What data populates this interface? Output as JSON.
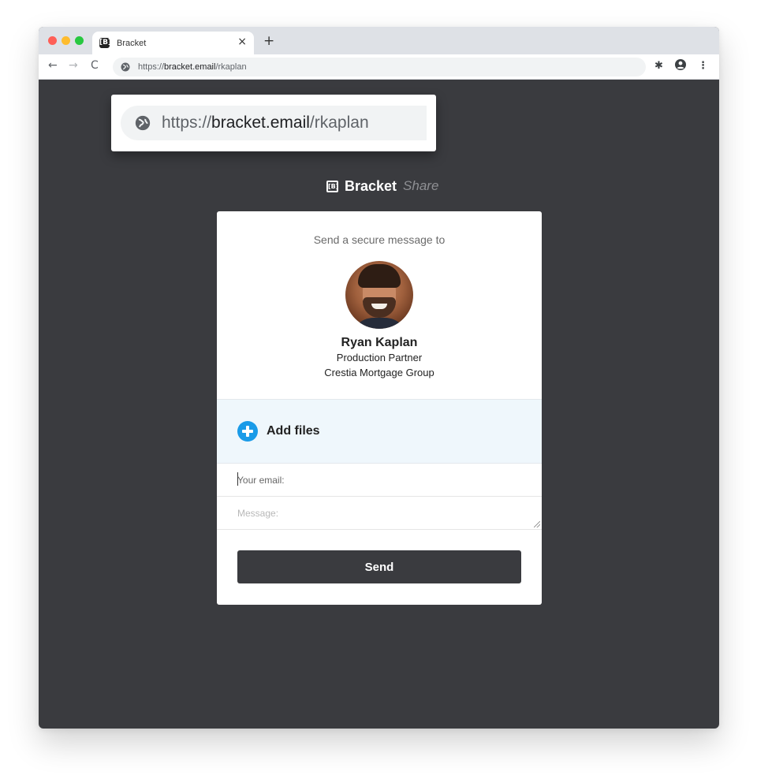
{
  "browser": {
    "tab_title": "Bracket",
    "tab_favicon": "[B]",
    "tab_close": "×",
    "new_tab": "+",
    "url_scheme": "https://",
    "url_host": "bracket.email",
    "url_path": "/rkaplan",
    "nav": {
      "back": "←",
      "forward": "→",
      "reload": "C"
    },
    "toolbar": {
      "extensions": "✱",
      "menu": "⋮"
    }
  },
  "callout": {
    "url_scheme": "https://",
    "url_host": "bracket.email",
    "url_path": "/rkaplan"
  },
  "brand": {
    "icon": "[B]",
    "name": "Bracket",
    "sub": "Share"
  },
  "card": {
    "intro": "Send a secure message to",
    "person": {
      "name": "Ryan Kaplan",
      "title": "Production Partner",
      "company": "Crestia Mortgage Group"
    },
    "add_files_label": "Add files",
    "email_placeholder": "Your email:",
    "message_placeholder": "Message:",
    "send_label": "Send"
  },
  "colors": {
    "page_bg": "#3a3b3f",
    "accent": "#1a9be8",
    "button": "#3a3b3f",
    "dropzone_bg": "#eff7fc"
  },
  "icons": [
    "close-icon",
    "plus-icon",
    "back-arrow-icon",
    "forward-arrow-icon",
    "reload-icon",
    "globe-icon",
    "extensions-icon",
    "profile-icon",
    "menu-dots-icon",
    "add-circle-icon"
  ]
}
